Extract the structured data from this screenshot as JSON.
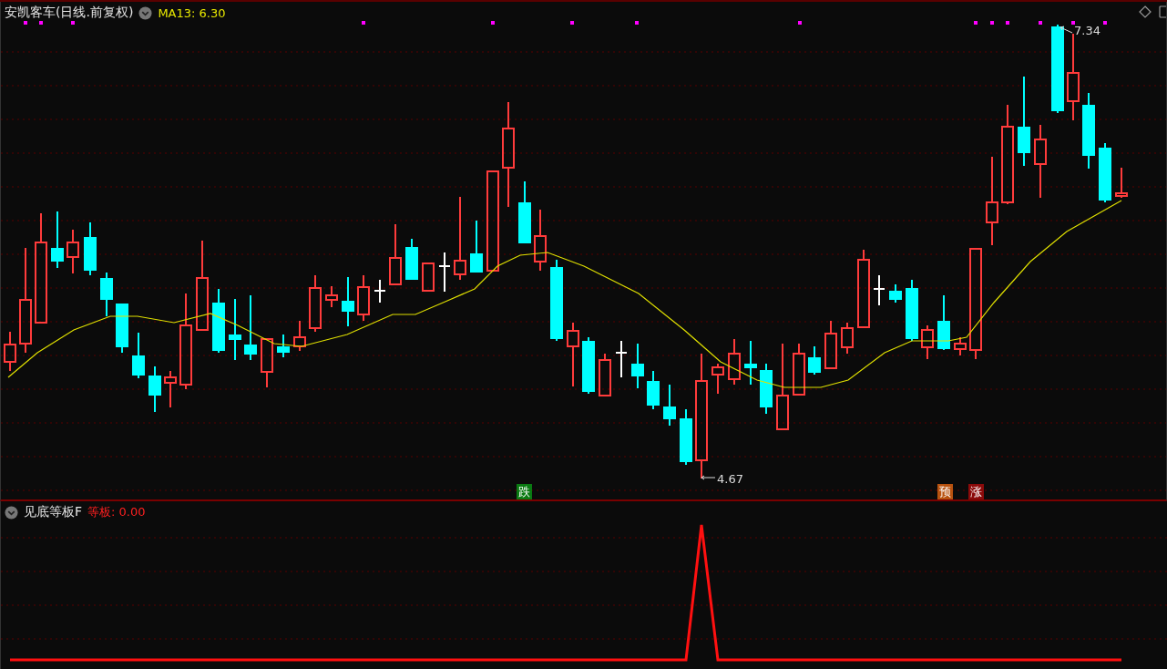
{
  "header": {
    "title": "安凯客车(日线.前复权)",
    "indicator": "MA13: 6.30"
  },
  "price_labels": [
    {
      "text": "7.34"
    },
    {
      "text": "4.67"
    }
  ],
  "signals": [
    {
      "text": "跌",
      "color": "#0a7a12"
    },
    {
      "text": "预",
      "color": "#b8520f"
    },
    {
      "text": "涨",
      "color": "#8b0a0a"
    }
  ],
  "sub_panel": {
    "title": "见底等板F",
    "value": "等板: 0.00"
  }
}
